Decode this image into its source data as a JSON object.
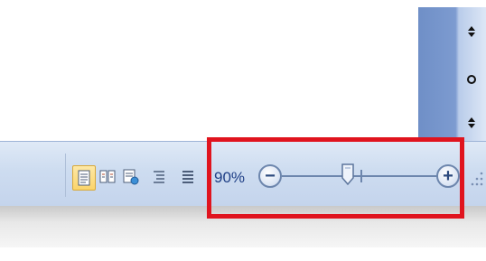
{
  "scrollbar": {
    "buttons": [
      {
        "icon": "previous-page-icon",
        "glyph": "⬍"
      },
      {
        "icon": "select-browse-object-icon",
        "glyph": "o"
      },
      {
        "icon": "next-page-icon",
        "glyph": "⬍"
      }
    ]
  },
  "status_bar": {
    "view_buttons": [
      {
        "icon": "print-layout-icon",
        "active": true
      },
      {
        "icon": "full-screen-reading-icon",
        "active": false
      },
      {
        "icon": "web-layout-icon",
        "active": false
      },
      {
        "icon": "outline-icon",
        "active": false
      },
      {
        "icon": "draft-icon",
        "active": false
      }
    ],
    "zoom": {
      "level_text": "90%",
      "zoom_out_glyph": "−",
      "zoom_in_glyph": "+",
      "level_value": 90
    }
  },
  "colors": {
    "highlight": "#e0141e",
    "zoom_text": "#1f3f86",
    "status_bar": "#cddcf0",
    "scrollbar": "#7d9bd0"
  }
}
